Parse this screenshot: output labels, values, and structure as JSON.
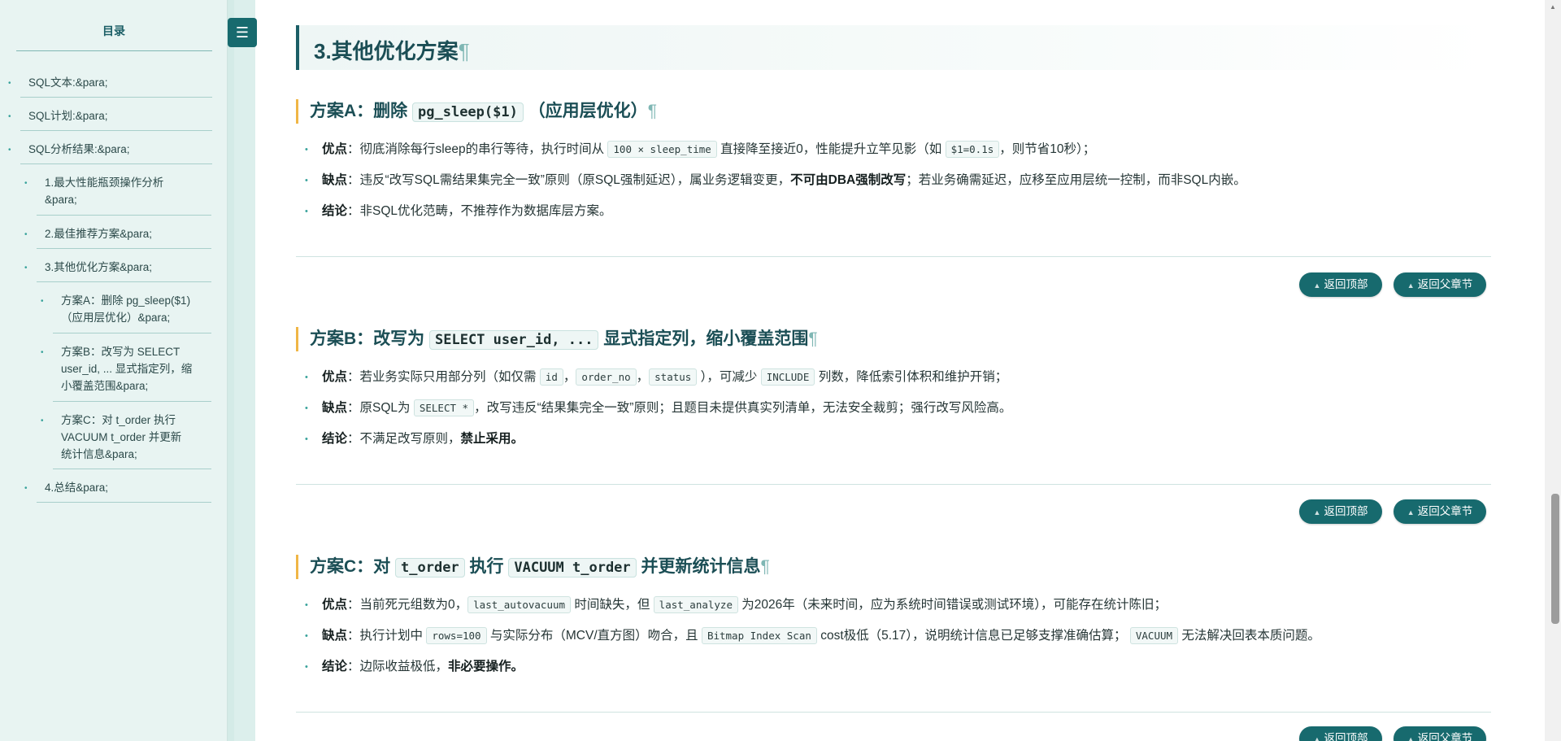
{
  "toc": {
    "title": "目录",
    "items": [
      {
        "label": "SQL文本:&para;"
      },
      {
        "label": "SQL计划:&para;"
      },
      {
        "label": "SQL分析结果:&para;"
      },
      {
        "label_line1": "1.最大性能瓶颈操作分析",
        "label_line2": "&para;"
      },
      {
        "label": "2.最佳推荐方案&para;"
      },
      {
        "label": "3.其他优化方案&para;"
      },
      {
        "label_line1": "方案A：删除 pg_sleep($1)",
        "label_line2": "（应用层优化）&para;"
      },
      {
        "label_line1": "方案B：改写为 SELECT",
        "label_line2": "user_id, ... 显式指定列，缩",
        "label_line3": "小覆盖范围&para;"
      },
      {
        "label_line1": "方案C：对 t_order 执行",
        "label_line2": "VACUUM t_order 并更新",
        "label_line3": "统计信息&para;"
      },
      {
        "label": "4.总结&para;"
      }
    ],
    "toggle_icon": "☰"
  },
  "section": {
    "title": "3.其他优化方案",
    "pilcrow": "¶"
  },
  "planA": {
    "title_prefix": "方案A：删除",
    "title_code": "pg_sleep($1)",
    "title_suffix": "（应用层优化）",
    "pros_label": "优点",
    "pros_1": "：彻底消除每行sleep的串行等待，执行时间从",
    "pros_code1": "100 × sleep_time",
    "pros_2": "直接降至接近0，性能提升立竿见影（如",
    "pros_code2": "$1=0.1s",
    "pros_3": "，则节省10秒）；",
    "cons_label": "缺点",
    "cons_1": "：违反“改写SQL需结果集完全一致”原则（原SQL强制延迟），属业务逻辑变更，",
    "cons_bold": "不可由DBA强制改写",
    "cons_2": "；若业务确需延迟，应移至应用层统一控制，而非SQL内嵌。",
    "concl_label": "结论",
    "concl_1": "：非SQL优化范畴，不推荐作为数据库层方案。"
  },
  "planB": {
    "title_prefix": "方案B：改写为",
    "title_code": "SELECT user_id, ...",
    "title_suffix": "显式指定列，缩小覆盖范围",
    "pros_label": "优点",
    "pros_1": "：若业务实际只用部分列（如仅需",
    "pros_code1": "id",
    "pros_sep1": "，",
    "pros_code2": "order_no",
    "pros_sep2": "，",
    "pros_code3": "status",
    "pros_2": "），可减少",
    "pros_code4": "INCLUDE",
    "pros_3": "列数，降低索引体积和维护开销；",
    "cons_label": "缺点",
    "cons_1": "：原SQL为",
    "cons_code1": "SELECT *",
    "cons_2": "，改写违反“结果集完全一致”原则；且题目未提供真实列清单，无法安全裁剪；强行改写风险高。",
    "concl_label": "结论",
    "concl_1": "：不满足改写原则，",
    "concl_bold": "禁止采用。"
  },
  "planC": {
    "title_prefix": "方案C：对",
    "title_code1": "t_order",
    "title_mid": "执行",
    "title_code2": "VACUUM t_order",
    "title_suffix": "并更新统计信息",
    "pros_label": "优点",
    "pros_1": "：当前死元组数为0，",
    "pros_code1": "last_autovacuum",
    "pros_2": "时间缺失，但",
    "pros_code2": "last_analyze",
    "pros_3": "为2026年（未来时间，应为系统时间错误或测试环境），可能存在统计陈旧；",
    "cons_label": "缺点",
    "cons_1": "：执行计划中",
    "cons_code1": "rows=100",
    "cons_2": "与实际分布（MCV/直方图）吻合，且",
    "cons_code2": "Bitmap Index Scan",
    "cons_3": "cost极低（5.17），说明统计信息已足够支撑准确估算；",
    "cons_code3": "VACUUM",
    "cons_4": "无法解决回表本质问题。",
    "concl_label": "结论",
    "concl_1": "：边际收益极低，",
    "concl_bold": "非必要操作。"
  },
  "buttons": {
    "back_top": "返回顶部",
    "back_parent": "返回父章节"
  },
  "colors": {
    "accent": "#176a6e",
    "heading": "#1b4e55",
    "marker": "#f0b646",
    "sidebar_bg": "#e8f4f2"
  }
}
